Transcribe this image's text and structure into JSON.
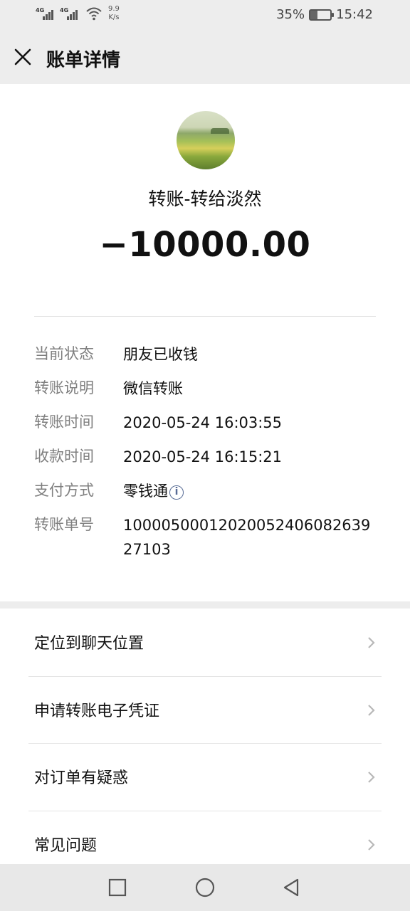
{
  "status_bar": {
    "signal1_label": "4G",
    "signal2_label": "4G",
    "net_speed_value": "9.9",
    "net_speed_unit": "K/s",
    "battery_percent": "35%",
    "battery_level": 0.35,
    "time": "15:42"
  },
  "title_bar": {
    "close_icon": "close-icon",
    "title": "账单详情"
  },
  "bill": {
    "payee_text": "转账-转给淡然",
    "amount": "−10000.00",
    "details": [
      {
        "label": "当前状态",
        "value": "朋友已收钱"
      },
      {
        "label": "转账说明",
        "value": "微信转账"
      },
      {
        "label": "转账时间",
        "value": "2020-05-24 16:03:55"
      },
      {
        "label": "收款时间",
        "value": "2020-05-24 16:15:21"
      },
      {
        "label": "支付方式",
        "value": "零钱通",
        "icon": "info-icon"
      },
      {
        "label": "转账单号",
        "value": "1000050001202005240608263927103"
      }
    ]
  },
  "actions": [
    {
      "label": "定位到聊天位置"
    },
    {
      "label": "申请转账电子凭证"
    },
    {
      "label": "对订单有疑惑"
    },
    {
      "label": "常见问题"
    }
  ],
  "nav_bar": {
    "icons": [
      "square-recents-icon",
      "circle-home-icon",
      "triangle-back-icon"
    ]
  },
  "colors": {
    "background": "#ededed",
    "card": "#ffffff",
    "label_gray": "#7f7f7f",
    "link_blue": "#576b95"
  }
}
